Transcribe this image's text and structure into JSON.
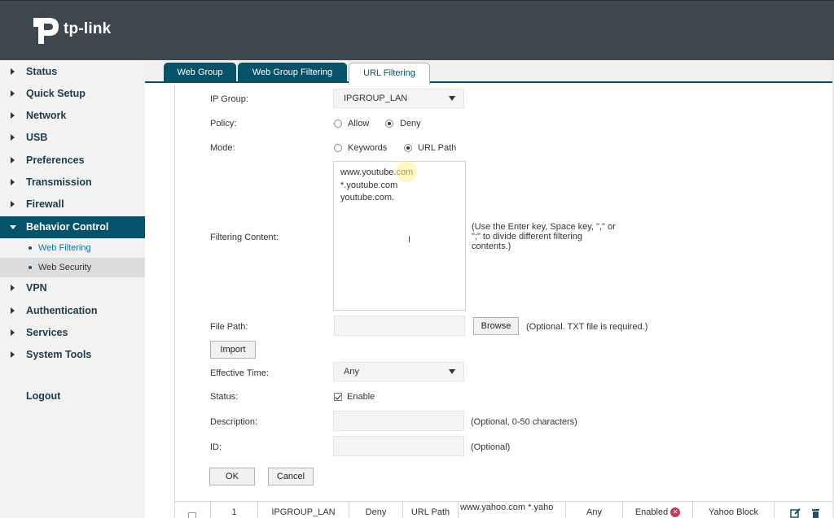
{
  "brand": {
    "logo_text": "tp-link"
  },
  "colors": {
    "header": "#3d474d",
    "accent": "#06526b",
    "sidebar": "#f2f2f2"
  },
  "sidebar": {
    "items": [
      {
        "label": "Status"
      },
      {
        "label": "Quick Setup"
      },
      {
        "label": "Network"
      },
      {
        "label": "USB"
      },
      {
        "label": "Preferences"
      },
      {
        "label": "Transmission"
      },
      {
        "label": "Firewall"
      },
      {
        "label": "Behavior Control"
      },
      {
        "label": "VPN"
      },
      {
        "label": "Authentication"
      },
      {
        "label": "Services"
      },
      {
        "label": "System Tools"
      }
    ],
    "subitems": [
      {
        "label": "Web Filtering"
      },
      {
        "label": "Web Security"
      }
    ],
    "logout": "Logout"
  },
  "tabs": [
    {
      "label": "Web Group"
    },
    {
      "label": "Web Group Filtering"
    },
    {
      "label": "URL Filtering"
    }
  ],
  "form": {
    "ip_group": {
      "label": "IP Group:",
      "value": "IPGROUP_LAN"
    },
    "policy": {
      "label": "Policy:",
      "options": [
        "Allow",
        "Deny"
      ],
      "selected": "Deny"
    },
    "mode": {
      "label": "Mode:",
      "options": [
        "Keywords",
        "URL Path"
      ],
      "selected": "URL Path"
    },
    "filtering_content": {
      "label": "Filtering Content:",
      "value": "www.youtube.com\n*.youtube.com\nyoutube.com.",
      "hint": "(Use the Enter key, Space key, \",\" or\n\";\" to divide different filtering\ncontents.)"
    },
    "file_path": {
      "label": "File Path:",
      "browse": "Browse",
      "hint": "(Optional. TXT file is required.)"
    },
    "import": "Import",
    "effective_time": {
      "label": "Effective Time:",
      "value": "Any"
    },
    "status": {
      "label": "Status:",
      "checkbox_label": "Enable"
    },
    "description": {
      "label": "Description:",
      "hint": "(Optional, 0-50 characters)"
    },
    "id": {
      "label": "ID:",
      "hint": "(Optional)"
    },
    "ok": "OK",
    "cancel": "Cancel"
  },
  "table": {
    "rows": [
      {
        "index": "1",
        "ip_group": "IPGROUP_LAN",
        "policy": "Deny",
        "mode": "URL Path",
        "content": "www.yahoo.com  *.yaho",
        "time": "Any",
        "status": "Enabled",
        "description": "Yahoo Block"
      }
    ]
  }
}
